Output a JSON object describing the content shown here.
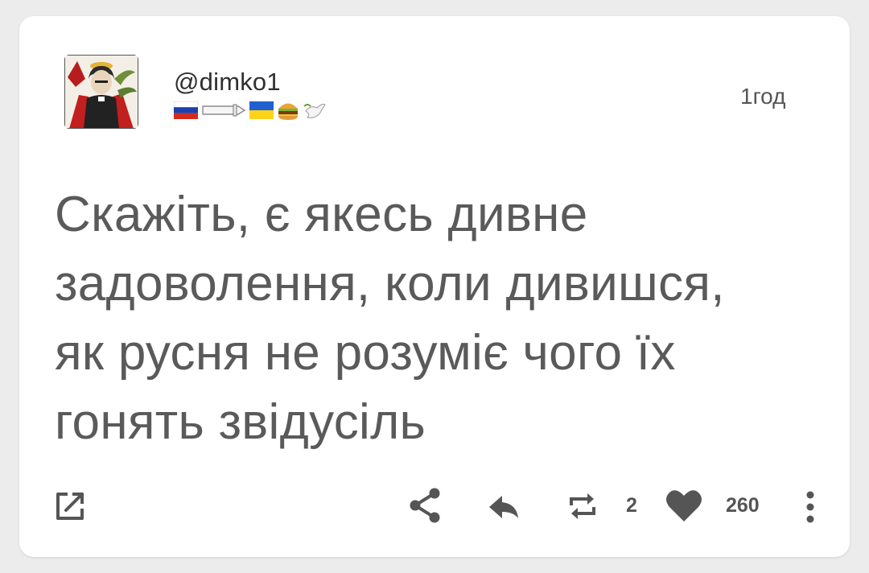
{
  "post": {
    "username": "@dimko1",
    "time": "1год",
    "text": "Скажіть, є якесь дивне\nзадоволення, коли дивишся,\nяк русня не розуміє чого їх\nгонять звідусіль",
    "badges": [
      "flag-russia",
      "sword",
      "flag-ukraine",
      "burger",
      "dove"
    ]
  },
  "actions": {
    "open_external_icon": "open-external-icon",
    "share_icon": "share-icon",
    "reply_icon": "reply-icon",
    "repost_icon": "repost-icon",
    "repost_count": "2",
    "like_icon": "heart-icon",
    "like_count": "260",
    "more_icon": "more-vertical-icon"
  },
  "colors": {
    "icon": "#555555",
    "text": "#5a5a5a",
    "card": "#ffffff",
    "background": "#ececec"
  }
}
